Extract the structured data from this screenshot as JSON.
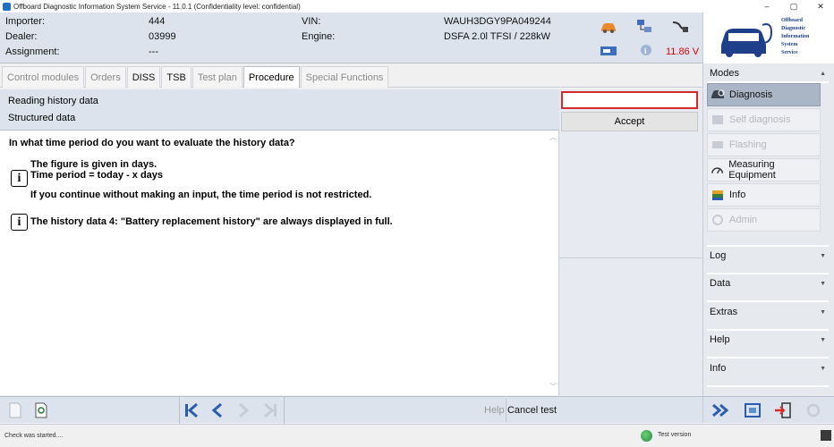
{
  "window": {
    "title": "Offboard Diagnostic Information System Service - 11.0.1 (Confidentiality level: confidential)",
    "controls": [
      "–",
      "▢",
      "✕"
    ]
  },
  "header": {
    "importer_label": "Importer:",
    "importer_value": "444",
    "dealer_label": "Dealer:",
    "dealer_value": "03999",
    "assignment_label": "Assignment:",
    "assignment_value": "---",
    "vin_label": "VIN:",
    "vin_value": "WAUH3DGY9PA049244",
    "engine_label": "Engine:",
    "engine_value": "DSFA 2.0l TFSI / 228kW",
    "voltage": "11.86 V"
  },
  "logo": {
    "lines": [
      "Offboard",
      "Diagnostic",
      "Information",
      "System",
      "Service"
    ]
  },
  "tabs": [
    {
      "label": "Control modules",
      "state": "disabled"
    },
    {
      "label": "Orders",
      "state": "disabled"
    },
    {
      "label": "DISS",
      "state": "normal"
    },
    {
      "label": "TSB",
      "state": "normal"
    },
    {
      "label": "Test plan",
      "state": "disabled"
    },
    {
      "label": "Procedure",
      "state": "active"
    },
    {
      "label": "Special Functions",
      "state": "disabled"
    }
  ],
  "procedure": {
    "line1": "Reading history data",
    "line2": "Structured data",
    "question": "In what time period do you want to evaluate the history data?",
    "info1_line1": "The figure is given in days.",
    "info1_line2": "Time period = today - x days",
    "info1_line3": "If you continue without making an input, the time period is not restricted.",
    "info2": "The history data 4: \"Battery replacement history\" are always displayed in full."
  },
  "input_panel": {
    "value": "",
    "accept_label": "Accept"
  },
  "bottom": {
    "help_label": "Help",
    "cancel_label": "Cancel test"
  },
  "sidebar": {
    "modes_label": "Modes",
    "items": [
      {
        "label": "Diagnosis",
        "state": "active"
      },
      {
        "label": "Self diagnosis",
        "state": "disabled"
      },
      {
        "label": "Flashing",
        "state": "disabled"
      },
      {
        "label": "Measuring Equipment",
        "state": "normal"
      },
      {
        "label": "Info",
        "state": "normal"
      },
      {
        "label": "Admin",
        "state": "disabled"
      }
    ],
    "sections": [
      "Log",
      "Data",
      "Extras",
      "Help",
      "Info"
    ]
  },
  "status": {
    "left": "Check was started....",
    "right": "Test version"
  },
  "colors": {
    "header_bg": "#dde3ec",
    "active_mode": "#aab6c6",
    "input_border": "#d42a2a",
    "voltage": "#d00000"
  }
}
